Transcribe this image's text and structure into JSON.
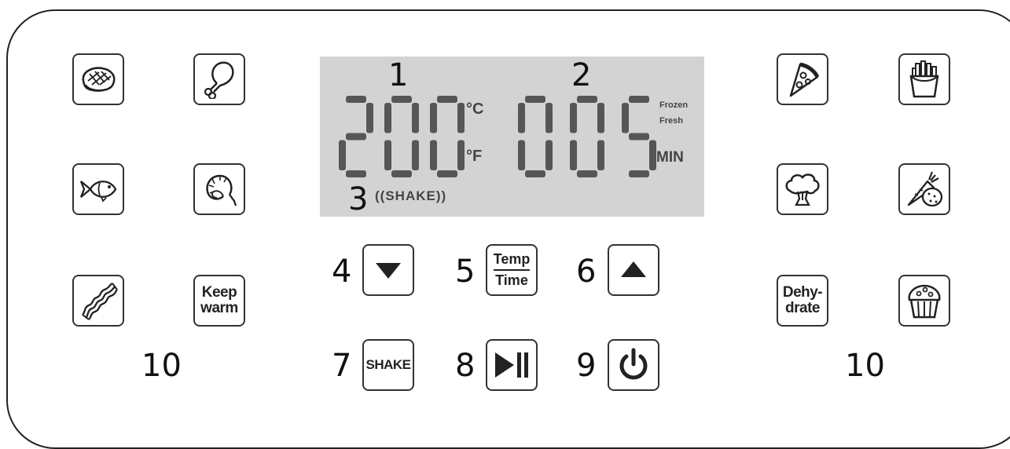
{
  "display": {
    "temperature": "200",
    "time": "005",
    "unit_celsius": "°C",
    "unit_fahrenheit": "°F",
    "time_unit": "MIN",
    "mode_frozen": "Frozen",
    "mode_fresh": "Fresh",
    "shake_indicator": "((SHAKE))"
  },
  "callouts": {
    "n1": "1",
    "n2": "2",
    "n3": "3",
    "n4": "4",
    "n5": "5",
    "n6": "6",
    "n7": "7",
    "n8": "8",
    "n9": "9",
    "n10_left": "10",
    "n10_right": "10"
  },
  "buttons": {
    "keep_warm_line1": "Keep",
    "keep_warm_line2": "warm",
    "dehydrate_line1": "Dehy-",
    "dehydrate_line2": "drate",
    "temp_label": "Temp",
    "time_label": "Time",
    "shake_label": "SHAKE"
  },
  "icons": {
    "steak": "steak-icon",
    "drumstick": "drumstick-icon",
    "fish": "fish-icon",
    "shrimp": "shrimp-icon",
    "bacon": "bacon-icon",
    "pizza": "pizza-icon",
    "fries": "fries-icon",
    "broccoli": "broccoli-icon",
    "vegetables": "carrot-potato-icon",
    "muffin": "muffin-icon",
    "down": "down-arrow-icon",
    "up": "up-arrow-icon",
    "play_pause": "play-pause-icon",
    "power": "power-icon"
  },
  "colors": {
    "lcd_background": "#d3d3d3",
    "segment": "#565656",
    "outline": "#222222"
  }
}
